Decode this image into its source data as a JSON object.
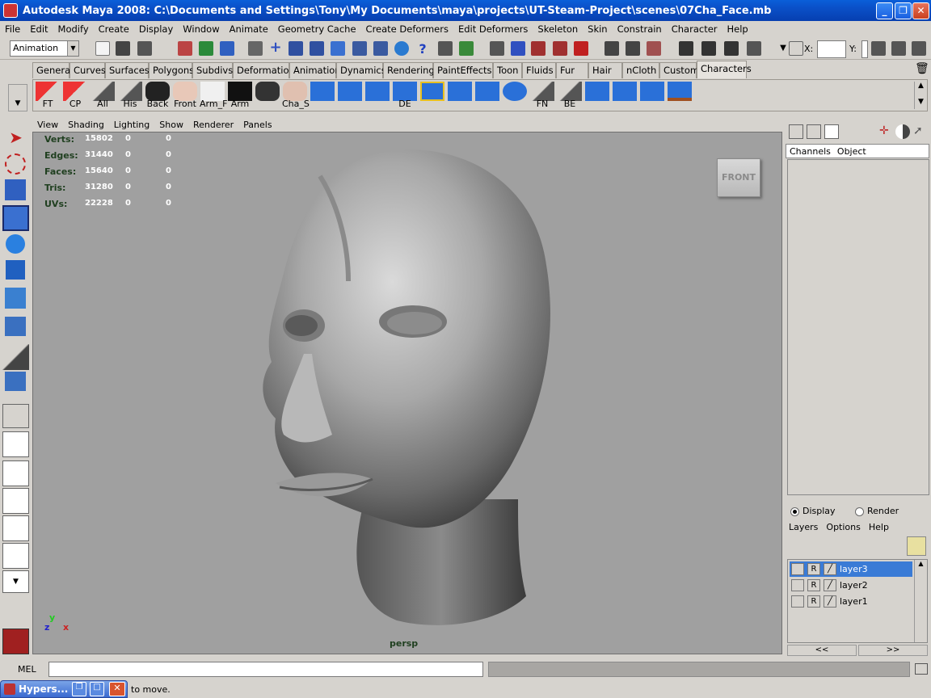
{
  "window": {
    "title": "Autodesk Maya 2008: C:\\Documents and Settings\\Tony\\My Documents\\maya\\projects\\UT-Steam-Project\\scenes\\07Cha_Face.mb"
  },
  "menubar": [
    "File",
    "Edit",
    "Modify",
    "Create",
    "Display",
    "Window",
    "Animate",
    "Geometry Cache",
    "Create Deformers",
    "Edit Deformers",
    "Skeleton",
    "Skin",
    "Constrain",
    "Character",
    "Help"
  ],
  "statusline": {
    "mode": "Animation",
    "x_label": "X:",
    "y_label": "Y:"
  },
  "shelf": {
    "tabs": [
      "General",
      "Curves",
      "Surfaces",
      "Polygons",
      "Subdivs",
      "Deformation",
      "Animation",
      "Dynamics",
      "Rendering",
      "PaintEffects",
      "Toon",
      "Fluids",
      "Fur",
      "Hair",
      "nCloth",
      "Custom",
      "Characters"
    ],
    "active_tab": "Characters",
    "buttons": [
      "FT",
      "CP",
      "All",
      "His",
      "Back",
      "Front",
      "Arm_F",
      "Arm",
      "Cha_S",
      "",
      "",
      "",
      "DE",
      "",
      "",
      "",
      "",
      "FN",
      "BE",
      "",
      "",
      "",
      ""
    ]
  },
  "viewport": {
    "menu": [
      "View",
      "Shading",
      "Lighting",
      "Show",
      "Renderer",
      "Panels"
    ],
    "hud": [
      {
        "label": "Verts:",
        "v1": "15802",
        "v2": "0",
        "v3": "0"
      },
      {
        "label": "Edges:",
        "v1": "31440",
        "v2": "0",
        "v3": "0"
      },
      {
        "label": "Faces:",
        "v1": "15640",
        "v2": "0",
        "v3": "0"
      },
      {
        "label": "Tris:",
        "v1": "31280",
        "v2": "0",
        "v3": "0"
      },
      {
        "label": "UVs:",
        "v1": "22228",
        "v2": "0",
        "v3": "0"
      }
    ],
    "camera_name": "persp",
    "viewcube_label": "FRONT",
    "axis": {
      "y": "y",
      "z": "z",
      "x": "x"
    },
    "colors": {
      "background": "#a0a0a0",
      "hud": "#1f3f1f"
    }
  },
  "channel_box": {
    "tabs": [
      "Channels",
      "Object"
    ]
  },
  "layer_editor": {
    "mode_display": "Display",
    "mode_render": "Render",
    "menu": [
      "Layers",
      "Options",
      "Help"
    ],
    "layers": [
      {
        "name": "layer3",
        "r": "R",
        "selected": true
      },
      {
        "name": "layer2",
        "r": "R",
        "selected": false
      },
      {
        "name": "layer1",
        "r": "R",
        "selected": false
      }
    ],
    "scroll_left": "<<",
    "scroll_right": ">>"
  },
  "command_line": {
    "label": "MEL"
  },
  "help_line": {
    "text": "to move."
  },
  "taskbar_window": {
    "title": "Hypers..."
  }
}
